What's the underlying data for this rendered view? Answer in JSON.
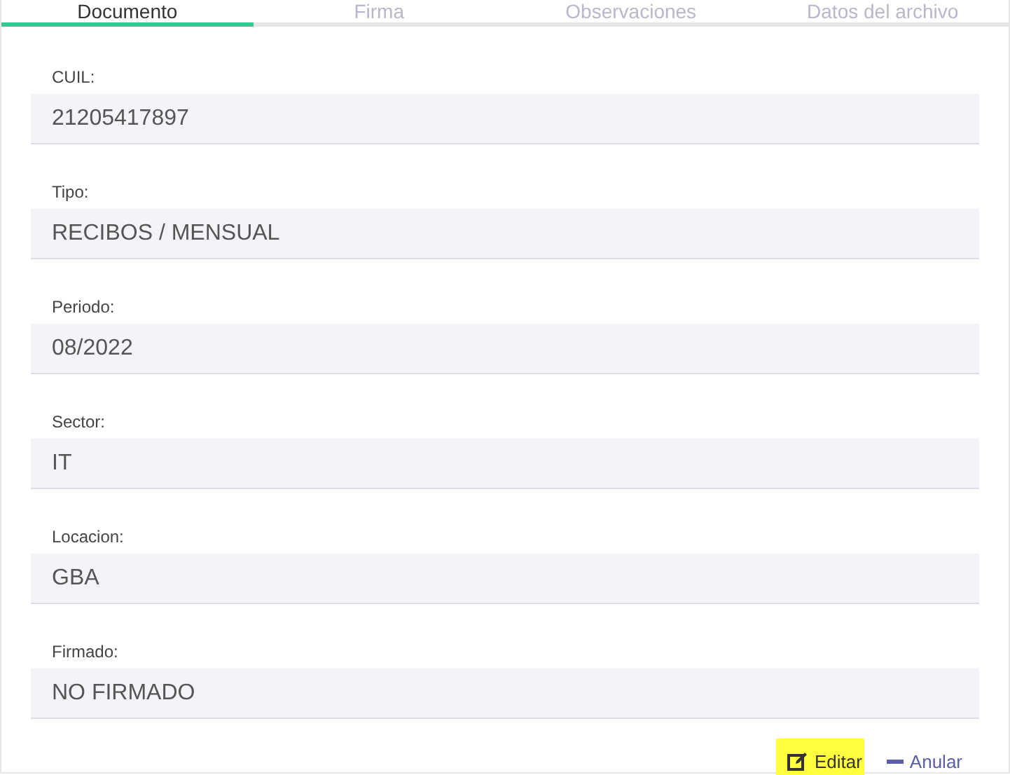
{
  "tabs": [
    {
      "label": "Documento",
      "selected": true
    },
    {
      "label": "Firma",
      "selected": false
    },
    {
      "label": "Observaciones",
      "selected": false
    },
    {
      "label": "Datos del archivo",
      "selected": false
    }
  ],
  "fields": [
    {
      "label": "CUIL:",
      "value": "21205417897"
    },
    {
      "label": "Tipo:",
      "value": "RECIBOS / MENSUAL"
    },
    {
      "label": "Periodo:",
      "value": "08/2022"
    },
    {
      "label": "Sector:",
      "value": "IT"
    },
    {
      "label": "Locacion:",
      "value": "GBA"
    },
    {
      "label": "Firmado:",
      "value": "NO FIRMADO"
    }
  ],
  "actions": [
    {
      "kind": "edit",
      "label": "Editar",
      "highlighted": true
    },
    {
      "kind": "cancel",
      "label": "Anular",
      "highlighted": false
    }
  ]
}
